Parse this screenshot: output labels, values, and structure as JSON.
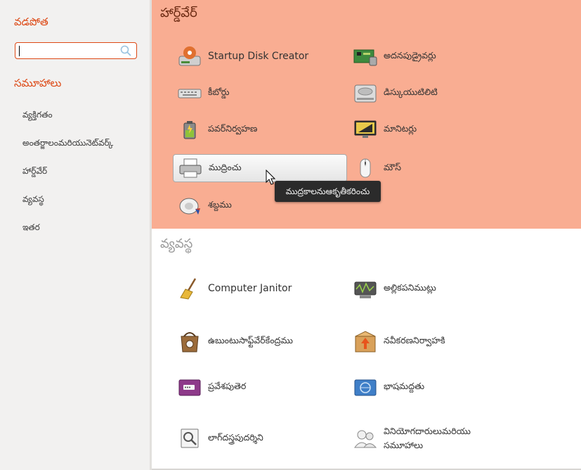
{
  "sidebar": {
    "filter_heading": "వడపోత",
    "search": {
      "value": "",
      "placeholder": ""
    },
    "groups_heading": "సమూహాలు",
    "groups": [
      "వ్యక్తిగతం",
      "అంతర్జాలంమరియునెట్‌వర్క్",
      "హార్డ్‌వేర్",
      "వ్యవస్థ",
      "ఇతర"
    ]
  },
  "hardware": {
    "title": "హార్డ్‌వేర్",
    "items": [
      {
        "label": "Startup Disk Creator",
        "icon": "startup-disk-icon"
      },
      {
        "label": "అదనపుడ్రైవర్లు",
        "icon": "additional-drivers-icon"
      },
      {
        "label": "కీబోర్డు",
        "icon": "keyboard-icon"
      },
      {
        "label": "డిస్కుయుటిలిటి",
        "icon": "disk-utility-icon"
      },
      {
        "label": "పవర్‌నిర్వహణ",
        "icon": "power-management-icon"
      },
      {
        "label": "మానిటర్లు",
        "icon": "monitors-icon"
      },
      {
        "label": "ముద్రించు",
        "icon": "printer-icon"
      },
      {
        "label": "మౌస్",
        "icon": "mouse-icon"
      },
      {
        "label": "శబ్దము",
        "icon": "sound-icon"
      }
    ],
    "tooltip": "ముద్రకాలనుఆకృతీకరించు"
  },
  "system": {
    "title": "వ్యవస్థ",
    "items": [
      {
        "label": "Computer Janitor",
        "icon": "broom-icon"
      },
      {
        "label": "అల్లికపనిముట్లు",
        "icon": "weave-tools-icon"
      },
      {
        "label": "ఉబుంటుసాఫ్ట్‌వేర్‌కేంద్రము",
        "icon": "software-center-icon"
      },
      {
        "label": "నవీకరణనిర్వాహకి",
        "icon": "update-manager-icon"
      },
      {
        "label": "ప్రవేశపుతెర",
        "icon": "login-screen-icon"
      },
      {
        "label": "భాషమద్దతు",
        "icon": "language-support-icon"
      },
      {
        "label": "లాగ్‌దస్త్రపుదర్శిని",
        "icon": "log-viewer-icon"
      },
      {
        "label": "వినియోగదారులుమరియు",
        "icon": "users-groups-icon"
      },
      {
        "label": "సమూహాలు",
        "icon": "users-groups-icon"
      }
    ]
  },
  "colors": {
    "accent": "#dd4814",
    "hardware_bg": "#f9ad92",
    "sidebar_bg": "#f2f1f0",
    "tooltip_bg": "#2b2b2b"
  }
}
